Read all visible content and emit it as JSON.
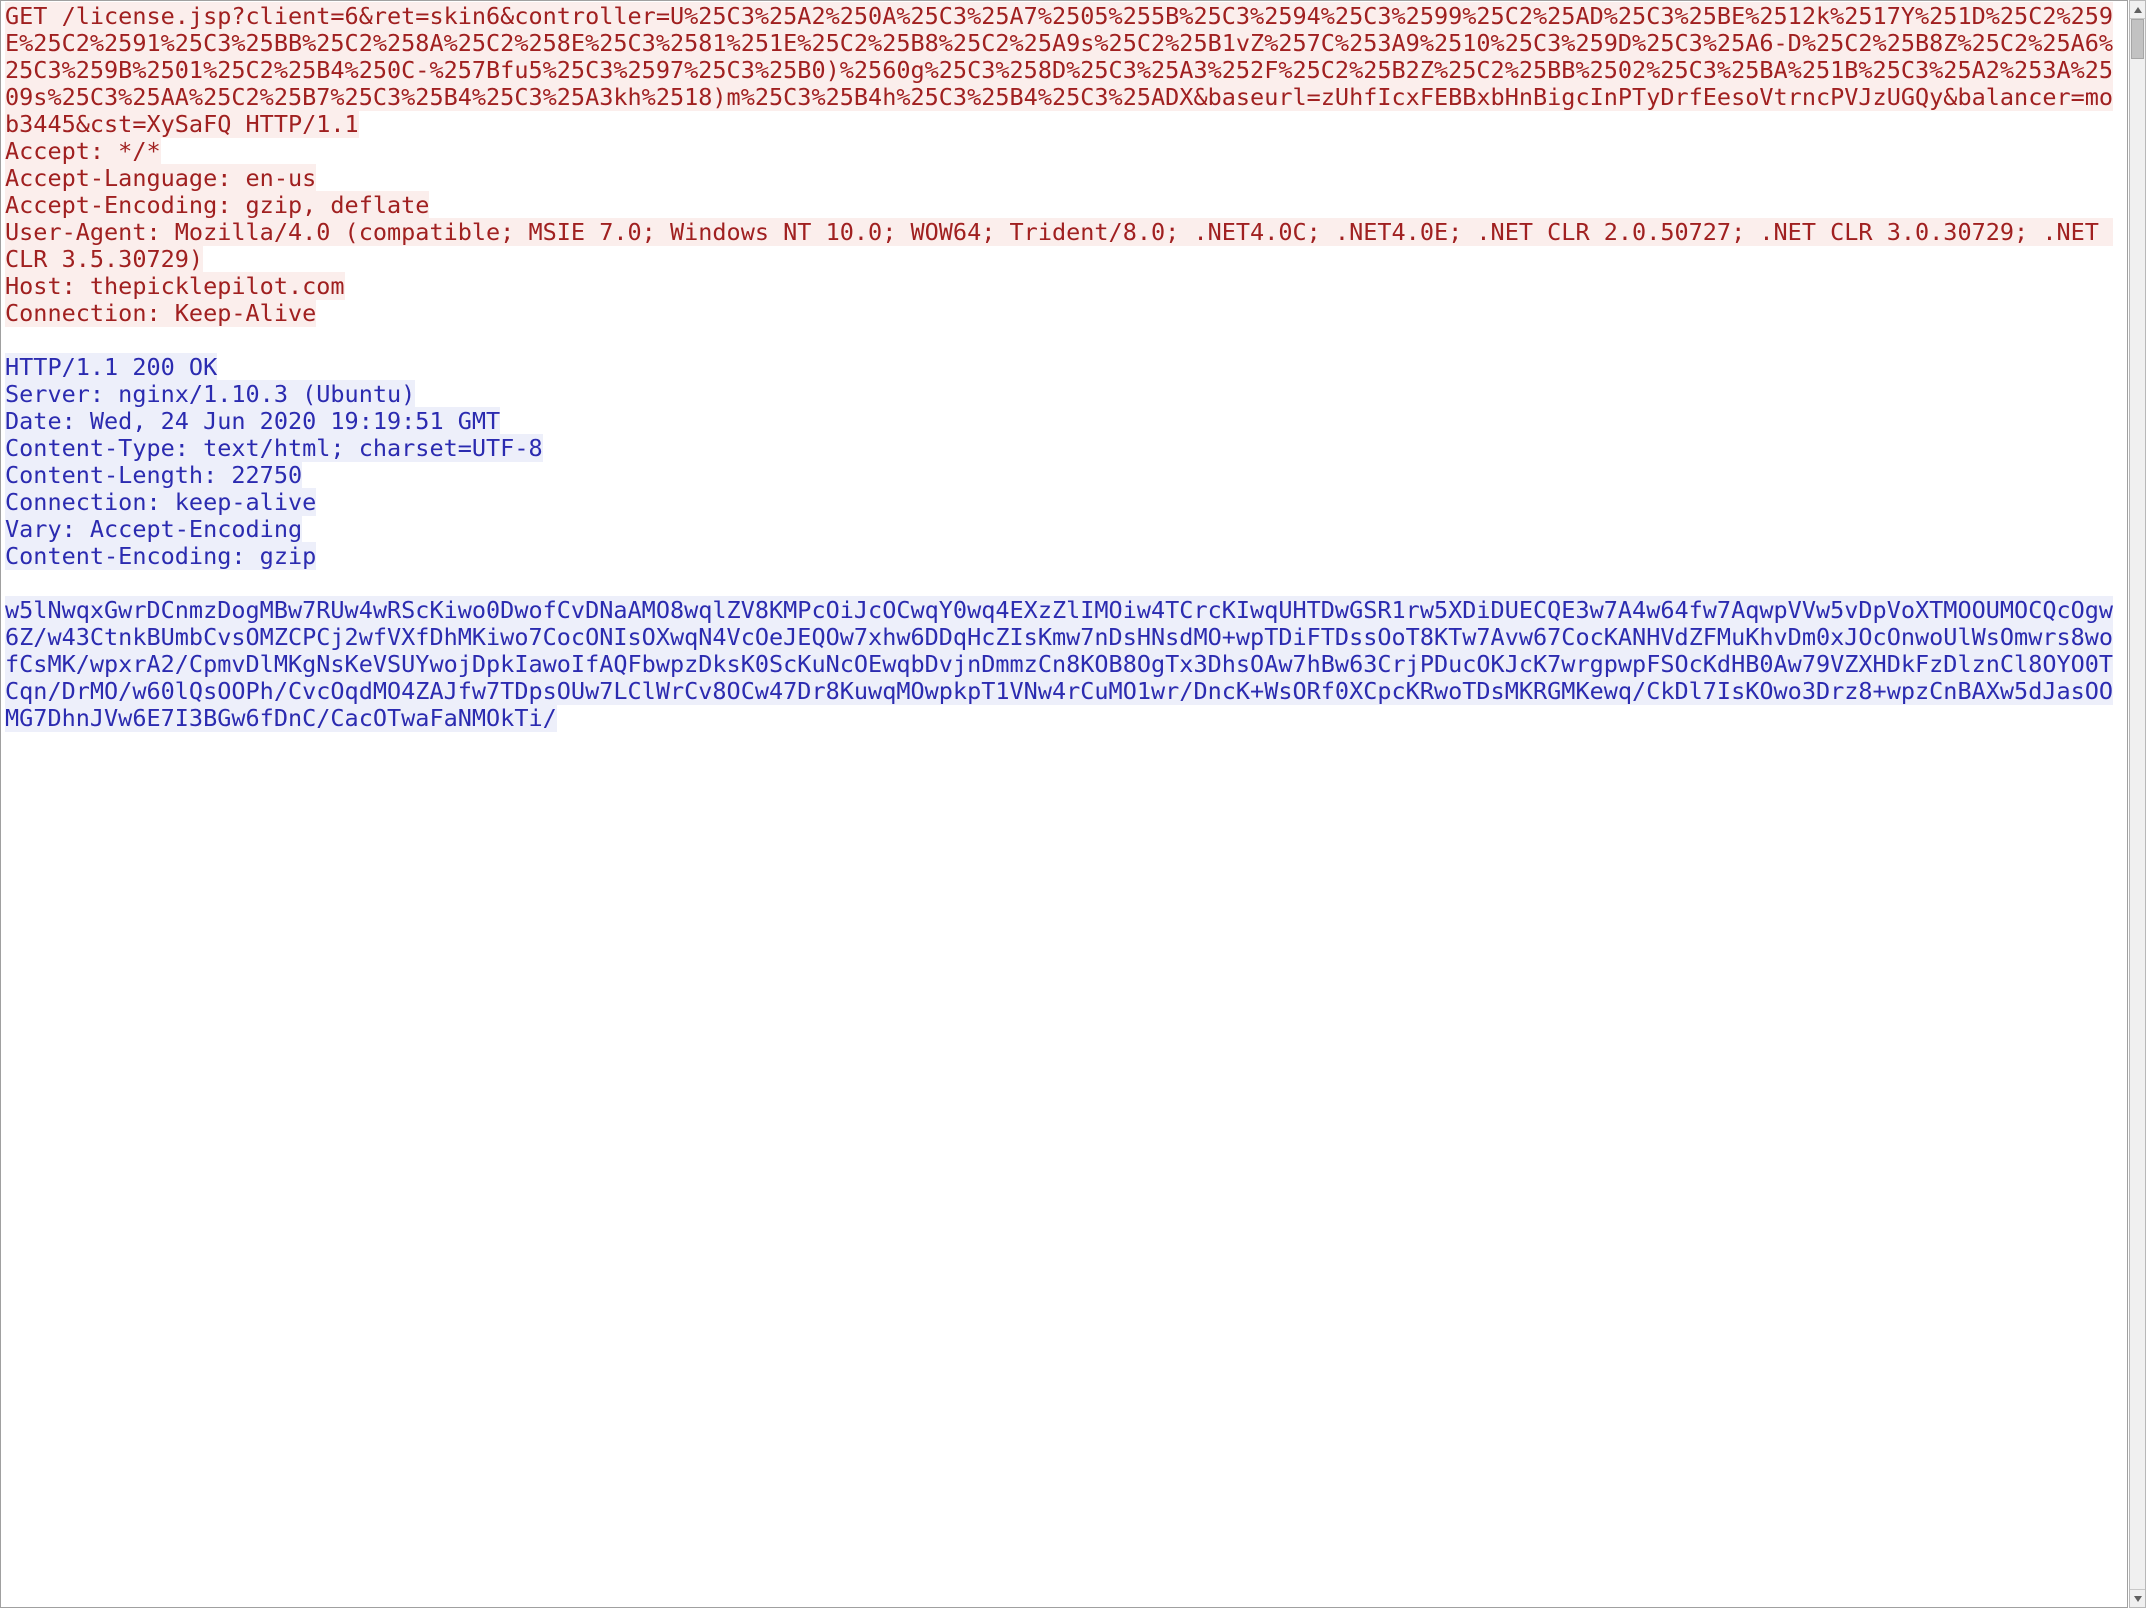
{
  "request": {
    "line1": "GET /license.jsp?client=6&ret=skin6&controller=U%25C3%25A2%250A%25C3%25A7%2505%255B%25C3%2594%25C3%2599%25C2%25AD%25C3%25BE%2512k%2517Y%251D%25C2%259E%25C2%2591%25C3%25BB%25C2%258A%25C2%258E%25C3%2581%251E%25C2%25B8%25C2%25A9s%25C2%25B1vZ%257C%253A9%2510%25C3%259D%25C3%25A6-D%25C2%25B8Z%25C2%25A6%25C3%259B%2501%25C2%25B4%250C-%257Bfu5%25C3%2597%25C3%25B0)%2560g%25C3%258D%25C3%25A3%252F%25C2%25B2Z%25C2%25BB%2502%25C3%25BA%251B%25C3%25A2%253A%2509s%25C3%25AA%25C2%25B7%25C3%25B4%25C3%25A3kh%2518)m%25C3%25B4h%25C3%25B4%25C3%25ADX&baseurl=zUhfIcxFEBBxbHnBigcInPTyDrfEesoVtrncPVJzUGQy&balancer=mob3445&cst=XySaFQ HTTP/1.1",
    "h_accept": "Accept: */*",
    "h_lang": "Accept-Language: en-us",
    "h_enc": "Accept-Encoding: gzip, deflate",
    "h_ua": "User-Agent: Mozilla/4.0 (compatible; MSIE 7.0; Windows NT 10.0; WOW64; Trident/8.0; .NET4.0C; .NET4.0E; .NET CLR 2.0.50727; .NET CLR 3.0.30729; .NET CLR 3.5.30729)",
    "h_host": "Host: thepicklepilot.com",
    "h_conn": "Connection: Keep-Alive"
  },
  "response": {
    "status": "HTTP/1.1 200 OK",
    "h_server": "Server: nginx/1.10.3 (Ubuntu)",
    "h_date": "Date: Wed, 24 Jun 2020 19:19:51 GMT",
    "h_ct": "Content-Type: text/html; charset=UTF-8",
    "h_cl": "Content-Length: 22750",
    "h_conn": "Connection: keep-alive",
    "h_vary": "Vary: Accept-Encoding",
    "h_ce": "Content-Encoding: gzip",
    "body": "w5lNwqxGwrDCnmzDogMBw7RUw4wRScKiwo0DwofCvDNaAMO8wqlZV8KMPcOiJcOCwqY0wq4EXzZlIMOiw4TCrcKIwqUHTDwGSR1rw5XDiDUECQE3w7A4w64fw7AqwpVVw5vDpVoXTMOOUMOCQcOgw6Z/w43CtnkBUmbCvsOMZCPCj2wfVXfDhMKiwo7CocONIsOXwqN4VcOeJEQOw7xhw6DDqHcZIsKmw7nDsHNsdMO+wpTDiFTDssOoT8KTw7Avw67CocKANHVdZFMuKhvDm0xJOcOnwoUlWsOmwrs8wofCsMK/wpxrA2/CpmvDlMKgNsKeVSUYwojDpkIawoIfAQFbwpzDksK0ScKuNcOEwqbDvjnDmmzCn8KOB8OgTx3DhsOAw7hBw63CrjPDucOKJcK7wrgpwpFSOcKdHB0Aw79VZXHDkFzDlznCl8OYO0TCqn/DrMO/w60lQsOOPh/CvcOqdMO4ZAJfw7TDpsOUw7LClWrCv8OCw47Dr8KuwqMOwpkpT1VNw4rCuMO1wr/DncK+WsORf0XCpcKRwoTDsMKRGMKewq/CkDl7IsKOwo3Drz8+wpzCnBAXw5dJasOOMG7DhnJVw6E7I3BGw6fDnC/CacOTwaFaNMOkTi/"
  }
}
